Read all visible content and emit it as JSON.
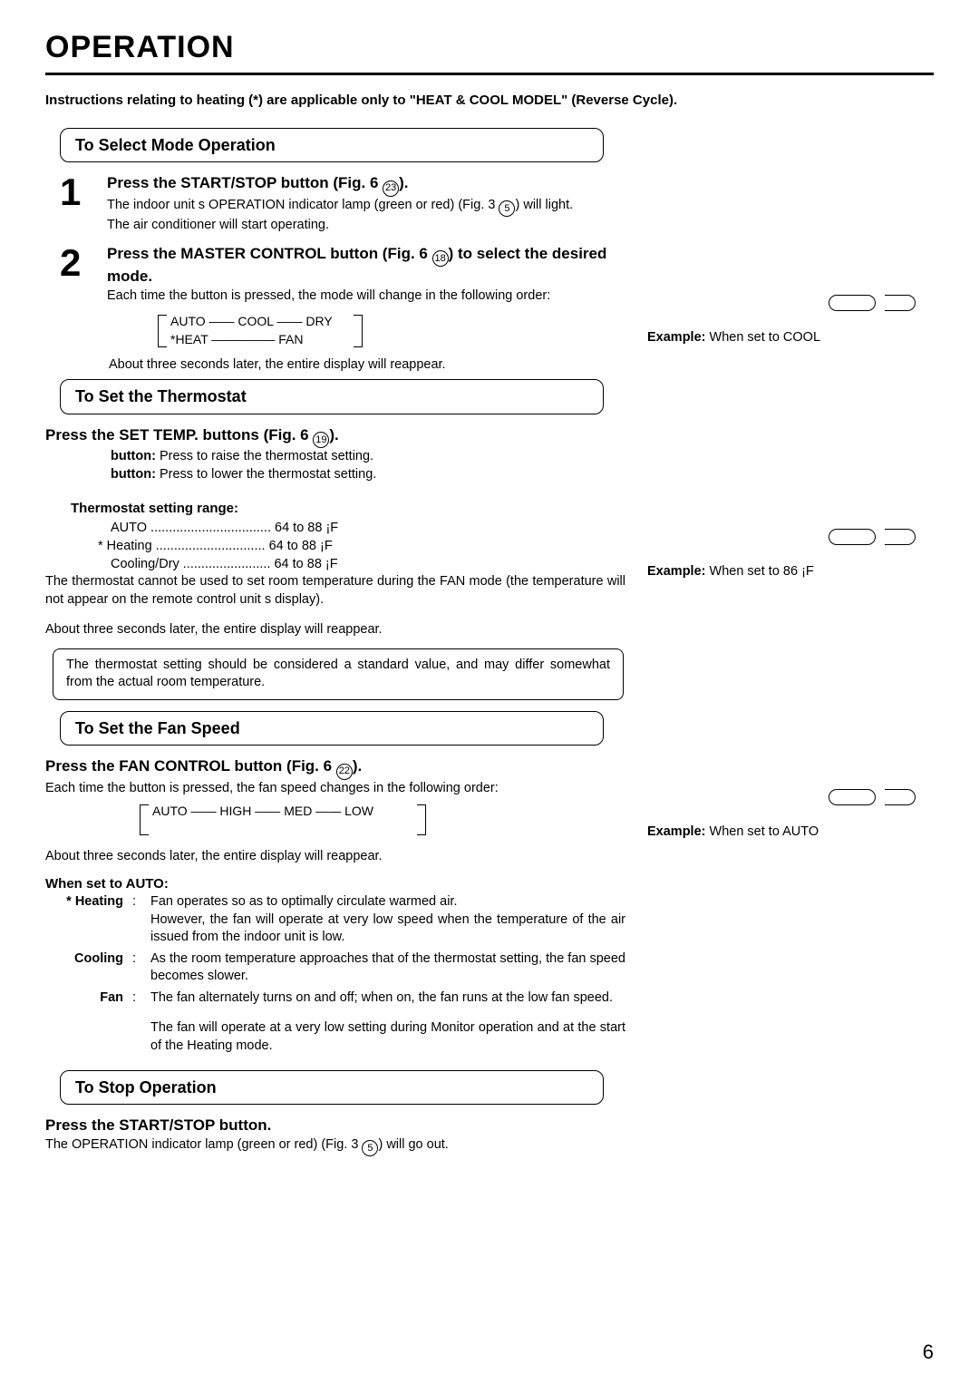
{
  "page": {
    "title": "OPERATION",
    "heat_note": "Instructions relating to heating (*) are applicable only to \"HEAT & COOL MODEL\" (Reverse Cycle).",
    "number": "6"
  },
  "sections": {
    "select_mode": "To Select Mode Operation",
    "thermostat": "To Set the Thermostat",
    "fan_speed": "To Set the Fan Speed",
    "stop": "To Stop Operation"
  },
  "step1": {
    "num": "1",
    "head_a": "Press the START/STOP button (Fig. 6 ",
    "head_ref": "23",
    "head_b": ").",
    "line1_a": "The indoor unit s OPERATION indicator lamp (green or red) (Fig. 3 ",
    "line1_ref": "5",
    "line1_b": ") will light.",
    "line2": "The air conditioner will start operating."
  },
  "step2": {
    "num": "2",
    "head_a": "Press the MASTER CONTROL button (Fig. 6 ",
    "head_ref": "18",
    "head_b": ") to select the desired mode.",
    "desc": "Each time the button is pressed, the mode will change in the following order:",
    "cycle_top": "AUTO —— COOL —— DRY",
    "cycle_bot": "*HEAT ————— FAN",
    "after": "About three seconds later, the entire display will reappear."
  },
  "thermo": {
    "head_a": "Press the SET TEMP. buttons (Fig. 6 ",
    "head_ref": "19",
    "head_b": ").",
    "btn_raise": " Press to raise the thermostat setting.",
    "btn_lower": " Press to lower the thermostat setting.",
    "btn_label": "button:",
    "range_head": "Thermostat setting range:",
    "r1": "AUTO ................................. 64 to 88 ¡F",
    "r2": "*  Heating .............................. 64 to 88 ¡F",
    "r3": "Cooling/Dry ........................ 64 to 88 ¡F",
    "note1": "The thermostat cannot be used to set room temperature during the FAN mode (the temperature will not appear on the remote control unit s display).",
    "after": "About three seconds later, the entire display will reappear.",
    "box": "The thermostat setting should be considered a standard value, and may differ somewhat from the actual room temperature."
  },
  "fan": {
    "head_a": "Press the FAN CONTROL button (Fig. 6 ",
    "head_ref": "22",
    "head_b": ").",
    "desc": "Each time the button is pressed, the fan speed changes in the following order:",
    "cycle": "AUTO —— HIGH —— MED —— LOW",
    "after": "About three seconds later, the entire display will reappear.",
    "auto_head": "When set to AUTO:",
    "heating_label": "* Heating",
    "heating_body": "Fan operates so as to optimally circulate warmed air.\nHowever, the fan will operate at very low speed when the temperature of the air issued from the indoor unit is low.",
    "cooling_label": "Cooling",
    "cooling_body": "As the room temperature approaches that of the thermostat setting, the fan speed becomes slower.",
    "fan_label": "Fan",
    "fan_body": "The fan alternately turns on and off; when on, the fan runs at the low fan speed.",
    "extra": "The fan will operate at a very low setting during Monitor operation and at the start of the Heating mode."
  },
  "stop": {
    "head": "Press the START/STOP button.",
    "body_a": "The OPERATION indicator lamp (green or red) (Fig. 3 ",
    "body_ref": "5",
    "body_b": ") will go out."
  },
  "examples": {
    "cool_a": "Example:",
    "cool_b": " When set to COOL",
    "temp_a": "Example:",
    "temp_b": " When set to 86 ¡F",
    "auto_a": "Example:",
    "auto_b": " When set to AUTO"
  }
}
